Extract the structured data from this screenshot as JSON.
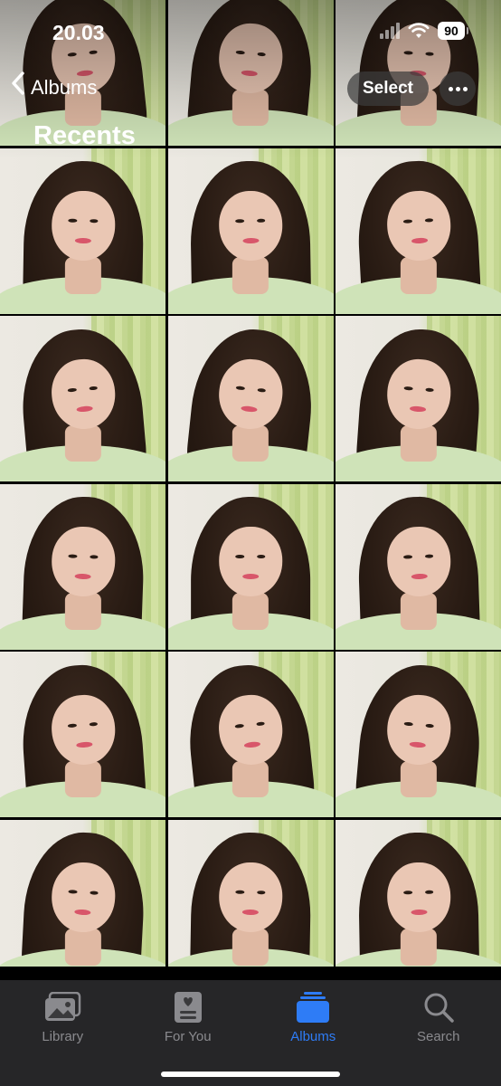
{
  "status_bar": {
    "time": "20.03",
    "battery": "90"
  },
  "nav": {
    "back_label": "Albums",
    "title": "Recents",
    "select_label": "Select",
    "more_icon": "ellipsis-icon"
  },
  "grid": {
    "columns": 3,
    "photo_count": 18
  },
  "tab_bar": {
    "items": [
      {
        "label": "Library",
        "icon": "library-icon"
      },
      {
        "label": "For You",
        "icon": "for-you-icon"
      },
      {
        "label": "Albums",
        "icon": "albums-icon"
      },
      {
        "label": "Search",
        "icon": "search-icon"
      }
    ],
    "active": "Albums"
  },
  "colors": {
    "accent": "#2e7cf6",
    "inactive": "#8a8a8e",
    "tabbar_bg": "#28282a"
  }
}
